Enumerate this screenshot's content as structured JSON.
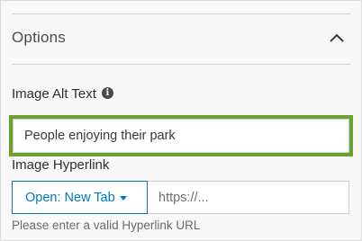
{
  "options": {
    "title": "Options",
    "expanded": true
  },
  "alt_text": {
    "label": "Image Alt Text",
    "info_icon": "info-icon",
    "value": "People enjoying their park",
    "focus_color": "#6aa12f"
  },
  "hyperlink": {
    "label": "Image Hyperlink",
    "target_label": "Open: New Tab",
    "url_placeholder": "https://...",
    "helper": "Please enter a valid Hyperlink URL",
    "accent_color": "#0079c1"
  }
}
